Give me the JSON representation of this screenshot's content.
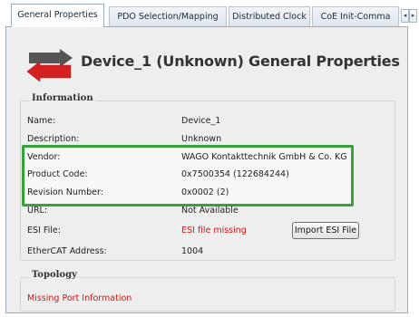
{
  "tabs": [
    {
      "label": "General Properties",
      "active": true
    },
    {
      "label": "PDO Selection/Mapping"
    },
    {
      "label": "Distributed Clock"
    },
    {
      "label": "CoE Init-Comma"
    }
  ],
  "tab_scroll": {
    "left_glyph": "◂",
    "right_glyph": "▸"
  },
  "header": {
    "title": "Device_1 (Unknown) General Properties",
    "icon": "device-arrows-icon"
  },
  "information": {
    "title": "Information",
    "name_label": "Name:",
    "name_value": "Device_1",
    "description_label": "Description:",
    "description_value": "Unknown",
    "vendor_label": "Vendor:",
    "vendor_value": "WAGO Kontakttechnik GmbH & Co. KG",
    "product_code_label": "Product Code:",
    "product_code_value": "0x7500354 (122684244)",
    "revision_label": "Revision Number:",
    "revision_value": "0x0002 (2)",
    "url_label": "URL:",
    "url_value": "Not Available",
    "esi_label": "ESI File:",
    "esi_value": "ESI file missing",
    "import_button": "Import ESI File",
    "ethercat_label": "EtherCAT Address:",
    "ethercat_value": "1004"
  },
  "topology": {
    "title": "Topology",
    "message": "Missing Port Information"
  },
  "colors": {
    "highlight": "#33a33a",
    "error": "#d01818",
    "arrow_red": "#d42020",
    "arrow_grey": "#555555"
  }
}
